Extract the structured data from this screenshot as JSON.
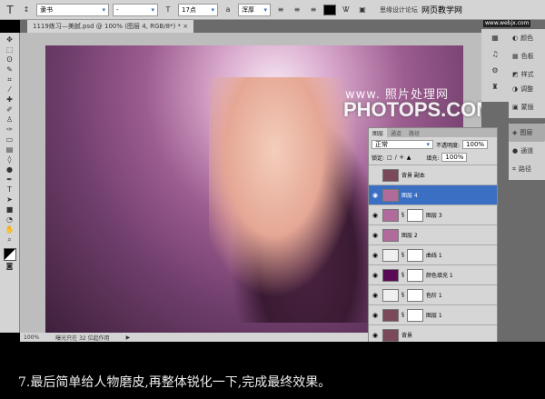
{
  "options_bar": {
    "font_family": "隶书",
    "font_style": "-",
    "font_size": "17点",
    "antialias": "浑厚",
    "site_label": "思缘设计论坛",
    "site_label2": "网页教学网",
    "site_url": "www.webjx.com"
  },
  "document": {
    "tab_title": "1119练习—美腻.psd @ 100% (图层 4, RGB/8*) *",
    "zoom": "100%",
    "status": "曝光只在 32 位起作用"
  },
  "watermark": {
    "line1": "www. 照片处理网",
    "line2": "PHOTOPS.COM"
  },
  "dock": {
    "group1": [
      "颜色",
      "色板",
      "样式"
    ],
    "group2": [
      "调整",
      "蒙版"
    ],
    "group3": [
      "图层",
      "通道",
      "路径"
    ]
  },
  "layers_panel": {
    "tabs": [
      "图层",
      "通道",
      "路径"
    ],
    "blend_mode": "正常",
    "opacity_label": "不透明度:",
    "opacity": "100%",
    "lock_label": "锁定:",
    "fill_label": "填充:",
    "fill": "100%",
    "layers": [
      {
        "name": "背景 副本",
        "visible": false,
        "mask": false,
        "thumb": "#7a4a5a"
      },
      {
        "name": "图层 4",
        "visible": true,
        "mask": false,
        "selected": true,
        "thumb": "#b06a9c"
      },
      {
        "name": "图层 3",
        "visible": true,
        "mask": true,
        "thumb": "#b06a9c"
      },
      {
        "name": "图层 2",
        "visible": true,
        "mask": false,
        "thumb": "#b06a9c"
      },
      {
        "name": "曲线 1",
        "visible": true,
        "mask": true,
        "thumb": "#f0f0f0"
      },
      {
        "name": "颜色填充 1",
        "visible": true,
        "mask": true,
        "thumb": "#5a0a55"
      },
      {
        "name": "色阶 1",
        "visible": true,
        "mask": true,
        "thumb": "#f0f0f0"
      },
      {
        "name": "图层 1",
        "visible": true,
        "mask": true,
        "thumb": "#7a4a5a"
      },
      {
        "name": "背景",
        "visible": true,
        "mask": false,
        "thumb": "#7a4a5a"
      }
    ]
  },
  "caption": "7.最后简单给人物磨皮,再整体锐化一下,完成最终效果。"
}
